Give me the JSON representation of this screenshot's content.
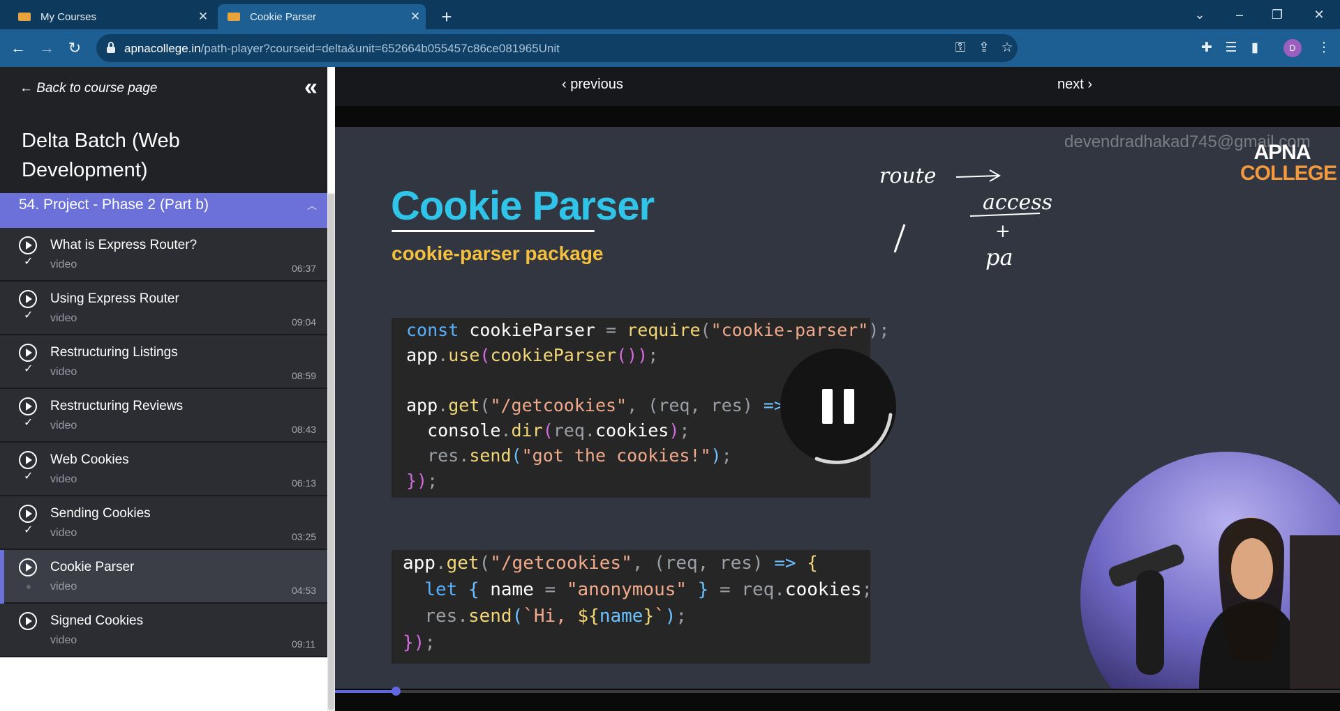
{
  "browser": {
    "tabs": [
      {
        "title": "My Courses",
        "active": false
      },
      {
        "title": "Cookie Parser",
        "active": true
      }
    ],
    "url_host": "apnacollege.in",
    "url_path": "/path-player?courseid=delta&unit=652664b055457c86ce081965Unit",
    "avatar_initial": "D"
  },
  "sidebar": {
    "back_link": "← Back to course page",
    "course_title": "Delta Batch (Web Development)",
    "section_title": "54. Project - Phase 2 (Part b)",
    "items": [
      {
        "title": "What is Express Router?",
        "type": "video",
        "duration": "06:37",
        "completed": true
      },
      {
        "title": "Using Express Router",
        "type": "video",
        "duration": "09:04",
        "completed": true
      },
      {
        "title": "Restructuring Listings",
        "type": "video",
        "duration": "08:59",
        "completed": true
      },
      {
        "title": "Restructuring Reviews",
        "type": "video",
        "duration": "08:43",
        "completed": true
      },
      {
        "title": "Web Cookies",
        "type": "video",
        "duration": "06:13",
        "completed": true
      },
      {
        "title": "Sending Cookies",
        "type": "video",
        "duration": "03:25",
        "completed": true
      },
      {
        "title": "Cookie Parser",
        "type": "video",
        "duration": "04:53",
        "completed": false,
        "active": true
      },
      {
        "title": "Signed Cookies",
        "type": "video",
        "duration": "09:11",
        "completed": false
      }
    ]
  },
  "player": {
    "previous_label": "‹ previous",
    "next_label": "next ›",
    "progress_fraction": 0.06
  },
  "slide": {
    "title": "Cookie Parser",
    "subtitle": "cookie-parser package",
    "watermark_email": "devendradhakad745@gmail.com",
    "logo_line1": "APNA",
    "logo_line2": "COLLEGE",
    "handwriting": {
      "route": "route",
      "access": "access",
      "plus": "+",
      "pa": "pa"
    },
    "code_block_1": [
      "const cookieParser = require(\"cookie-parser\");",
      "app.use(cookieParser());",
      "",
      "app.get(\"/getcookies\", (req, res) => {",
      "  console.dir(req.cookies);",
      "  res.send(\"got the cookies!\");",
      "});"
    ],
    "code_block_2": [
      "app.get(\"/getcookies\", (req, res) => {",
      "  let { name = \"anonymous\" } = req.cookies;",
      "  res.send(`Hi, ${name}`);",
      "});"
    ]
  },
  "colors": {
    "accent": "#6b71d8",
    "title_cyan": "#2fc4e8",
    "subtitle_yellow": "#f4c03e",
    "browser_blue": "#1d5f93"
  }
}
